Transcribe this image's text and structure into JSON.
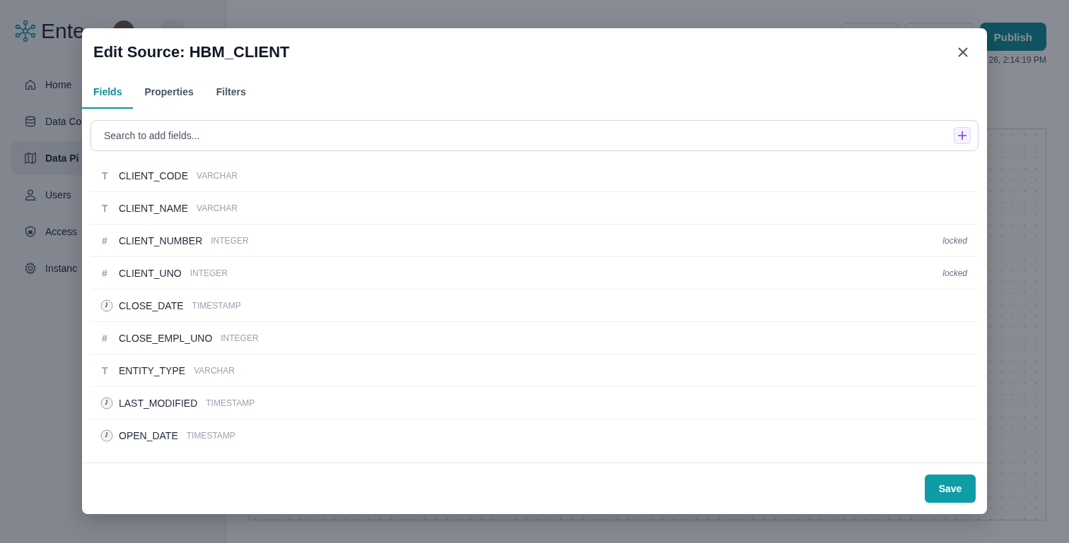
{
  "app": {
    "logo_text": "Ente"
  },
  "sidebar": {
    "items": [
      {
        "label": "Home",
        "selected": false
      },
      {
        "label": "Data Co",
        "selected": false
      },
      {
        "label": "Data Pi",
        "selected": true
      },
      {
        "label": "Users",
        "selected": false
      },
      {
        "label": "Access",
        "selected": false
      },
      {
        "label": "Instanc",
        "selected": false
      }
    ]
  },
  "header": {
    "publish_button": "Publish",
    "timestamp": "26, 2:14:19 PM"
  },
  "modal": {
    "title": "Edit Source: HBM_CLIENT",
    "tabs": [
      {
        "label": "Fields",
        "selected": true
      },
      {
        "label": "Properties",
        "selected": false
      },
      {
        "label": "Filters",
        "selected": false
      }
    ],
    "search": {
      "placeholder": "Search to add fields..."
    },
    "fields": [
      {
        "kind": "text",
        "type_icon": "T",
        "name": "CLIENT_CODE",
        "type": "VARCHAR"
      },
      {
        "kind": "text",
        "type_icon": "T",
        "name": "CLIENT_NAME",
        "type": "VARCHAR"
      },
      {
        "kind": "number",
        "type_icon": "#",
        "name": "CLIENT_NUMBER",
        "type": "INTEGER",
        "note": "locked"
      },
      {
        "kind": "number",
        "type_icon": "#",
        "name": "CLIENT_UNO",
        "type": "INTEGER",
        "note": "locked"
      },
      {
        "kind": "time",
        "name": "CLOSE_DATE",
        "type": "TIMESTAMP"
      },
      {
        "kind": "number",
        "type_icon": "#",
        "name": "CLOSE_EMPL_UNO",
        "type": "INTEGER"
      },
      {
        "kind": "text",
        "type_icon": "T",
        "name": "ENTITY_TYPE",
        "type": "VARCHAR"
      },
      {
        "kind": "time",
        "name": "LAST_MODIFIED",
        "type": "TIMESTAMP"
      },
      {
        "kind": "time",
        "name": "OPEN_DATE",
        "type": "TIMESTAMP"
      }
    ],
    "save_button": "Save"
  }
}
